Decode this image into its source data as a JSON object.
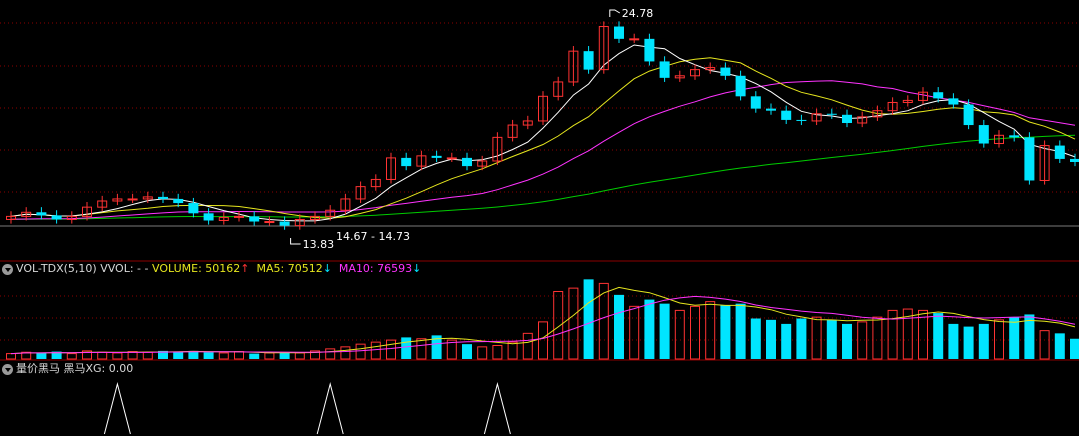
{
  "price_panel": {
    "high_label": "24.78",
    "low_label": "13.83",
    "range_label": "14.67 - 14.73"
  },
  "volume_panel": {
    "indicator_name": "VOL-TDX(5,10)",
    "vvol_text": "VVOL: -",
    "volume_text": "VOLUME: 50162",
    "volume_arrow": "↑",
    "ma5_text": "MA5: 70512",
    "ma5_arrow": "↓",
    "ma10_text": "MA10: 76593",
    "ma10_arrow": "↓"
  },
  "signal_panel": {
    "indicator_name": "量价黑马",
    "value_text": "黑马XG: 0.00"
  },
  "colors": {
    "background": "#000000",
    "up": "#ff3333",
    "down": "#00e5ff",
    "ma5": "#ffffff",
    "ma10": "#e6e61e",
    "ma20": "#ff33ff",
    "ma60": "#00cc00",
    "separator": "#8b0000",
    "gridline": "#8b0000"
  },
  "chart_data": [
    {
      "type": "candlestick",
      "title": "",
      "series_note": "",
      "x": [
        1,
        2,
        3,
        4,
        5,
        6,
        7,
        8,
        9,
        10,
        11,
        12,
        13,
        14,
        15,
        16,
        17,
        18,
        19,
        20,
        21,
        22,
        23,
        24,
        25,
        26,
        27,
        28,
        29,
        30,
        31,
        32,
        33,
        34,
        35,
        36,
        37,
        38,
        39,
        40,
        41,
        42,
        43,
        44,
        45,
        46,
        47,
        48,
        49,
        50,
        51,
        52,
        53,
        54,
        55,
        56,
        57,
        58,
        59,
        60,
        61,
        62,
        63,
        64,
        65,
        66,
        67,
        68,
        69,
        70,
        71
      ],
      "open": [
        14.6,
        14.75,
        14.95,
        14.8,
        14.6,
        14.75,
        15.2,
        15.5,
        15.6,
        15.6,
        15.7,
        15.6,
        15.4,
        14.9,
        14.55,
        14.7,
        14.75,
        14.5,
        14.5,
        14.3,
        14.6,
        14.75,
        15.05,
        15.6,
        16.2,
        16.55,
        17.6,
        17.2,
        17.7,
        17.6,
        17.6,
        17.2,
        17.45,
        18.6,
        19.2,
        19.4,
        20.6,
        21.3,
        22.8,
        21.9,
        24.0,
        23.4,
        23.4,
        22.3,
        21.5,
        21.6,
        21.9,
        22.0,
        21.6,
        20.6,
        20.0,
        19.9,
        19.45,
        19.4,
        19.75,
        19.7,
        19.3,
        19.6,
        19.9,
        20.3,
        20.4,
        20.8,
        20.5,
        20.2,
        19.2,
        18.3,
        18.7,
        18.6,
        16.5,
        18.2,
        17.55
      ],
      "close": [
        14.75,
        14.95,
        14.8,
        14.6,
        14.75,
        15.2,
        15.5,
        15.6,
        15.6,
        15.7,
        15.6,
        15.4,
        14.9,
        14.55,
        14.7,
        14.75,
        14.5,
        14.5,
        14.3,
        14.6,
        14.75,
        15.05,
        15.6,
        16.2,
        16.55,
        17.6,
        17.2,
        17.7,
        17.6,
        17.6,
        17.2,
        17.45,
        18.6,
        19.2,
        19.4,
        20.6,
        21.3,
        22.8,
        21.9,
        24.0,
        23.4,
        23.4,
        22.3,
        21.5,
        21.6,
        21.9,
        22.0,
        21.6,
        20.6,
        20.0,
        19.9,
        19.45,
        19.4,
        19.75,
        19.7,
        19.3,
        19.6,
        19.9,
        20.3,
        20.4,
        20.8,
        20.5,
        20.2,
        19.2,
        18.3,
        18.7,
        18.6,
        16.5,
        18.2,
        17.55,
        17.4
      ],
      "high_note": "24.78",
      "low_note": "13.83",
      "ma_series": [
        {
          "name": "MA5",
          "color": "#ffffff"
        },
        {
          "name": "MA10",
          "color": "#e6e61e"
        },
        {
          "name": "MA20",
          "color": "#ff33ff"
        },
        {
          "name": "MA60",
          "color": "#00cc00"
        }
      ]
    },
    {
      "type": "bar",
      "title": "VOL-TDX(5,10)",
      "volume": [
        8,
        10,
        9,
        11,
        8,
        12,
        10,
        9,
        11,
        10,
        12,
        11,
        12,
        10,
        9,
        11,
        8,
        9,
        10,
        9,
        12,
        15,
        18,
        22,
        25,
        28,
        32,
        30,
        35,
        28,
        22,
        18,
        20,
        25,
        38,
        55,
        100,
        105,
        118,
        112,
        95,
        78,
        88,
        82,
        72,
        78,
        85,
        80,
        82,
        60,
        58,
        52,
        60,
        62,
        58,
        52,
        55,
        62,
        72,
        74,
        72,
        68,
        52,
        48,
        52,
        58,
        62,
        66,
        42,
        38,
        30
      ],
      "ma_series": [
        {
          "name": "MA5",
          "value_label": "70512",
          "color": "#e6e61e"
        },
        {
          "name": "MA10",
          "value_label": "76593",
          "color": "#ff33ff"
        }
      ],
      "volume_label": "50162"
    },
    {
      "type": "line",
      "title": "量价黑马",
      "signal_label": "黑马XG: 0.00",
      "signals_at": [
        7,
        21,
        32
      ]
    }
  ]
}
